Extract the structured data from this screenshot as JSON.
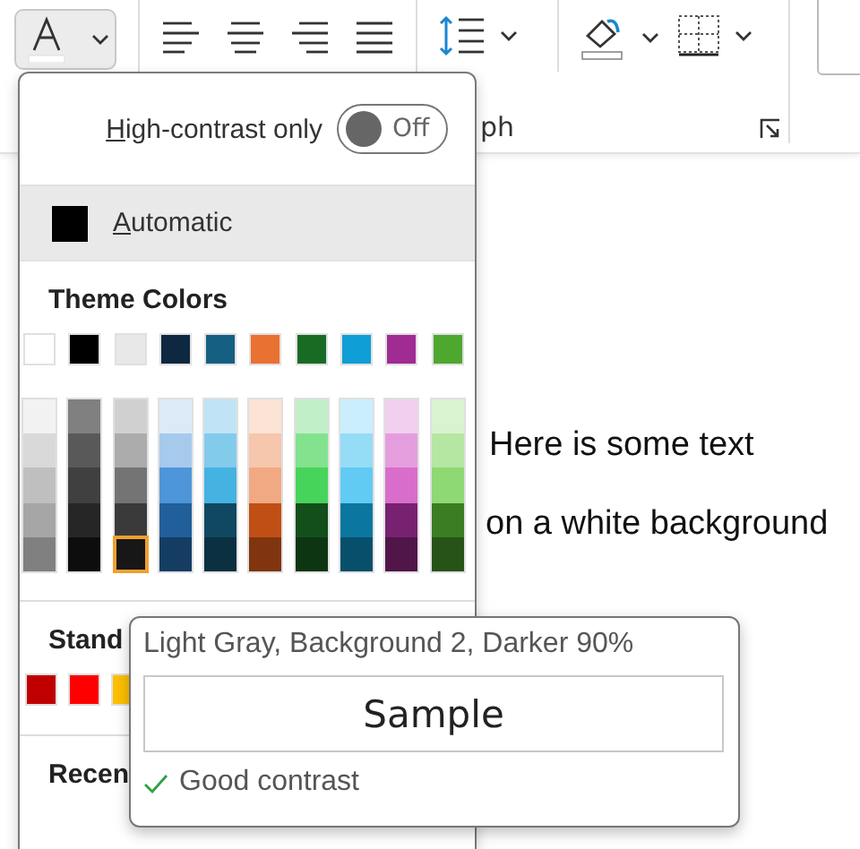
{
  "toolbar": {
    "group_label": "ph"
  },
  "document": {
    "lines": [
      "Here is some text",
      "on a white background"
    ]
  },
  "color_menu": {
    "high_contrast": {
      "label": "High-contrast only",
      "on": false,
      "state_text": "Off"
    },
    "automatic": {
      "label": "Automatic",
      "color": "#000000",
      "selected": true
    },
    "theme_title": "Theme Colors",
    "theme_colors": [
      {
        "color": "#ffffff",
        "selected": false,
        "shades": [
          {
            "color": "#f2f2f2",
            "selected": false
          },
          {
            "color": "#d9d9d9",
            "selected": false
          },
          {
            "color": "#bfbfbf",
            "selected": false
          },
          {
            "color": "#a6a6a6",
            "selected": false
          },
          {
            "color": "#808080",
            "selected": false
          }
        ]
      },
      {
        "color": "#000000",
        "selected": false,
        "shades": [
          {
            "color": "#808080",
            "selected": false
          },
          {
            "color": "#595959",
            "selected": false
          },
          {
            "color": "#404040",
            "selected": false
          },
          {
            "color": "#262626",
            "selected": false
          },
          {
            "color": "#0d0d0d",
            "selected": false
          }
        ]
      },
      {
        "color": "#e8e8e8",
        "selected": false,
        "shades": [
          {
            "color": "#d0d0d0",
            "selected": false
          },
          {
            "color": "#acacac",
            "selected": false
          },
          {
            "color": "#747474",
            "selected": false
          },
          {
            "color": "#3a3a3a",
            "selected": false
          },
          {
            "color": "#171717",
            "selected": true
          }
        ]
      },
      {
        "color": "#0e2841",
        "selected": false,
        "shades": [
          {
            "color": "#dceaf7",
            "selected": false
          },
          {
            "color": "#a6caec",
            "selected": false
          },
          {
            "color": "#4e95d9",
            "selected": false
          },
          {
            "color": "#215f9a",
            "selected": false
          },
          {
            "color": "#153d64",
            "selected": false
          }
        ]
      },
      {
        "color": "#156082",
        "selected": false,
        "shades": [
          {
            "color": "#c0e4f5",
            "selected": false
          },
          {
            "color": "#83cbeb",
            "selected": false
          },
          {
            "color": "#44b3e1",
            "selected": false
          },
          {
            "color": "#104862",
            "selected": false
          },
          {
            "color": "#0a3041",
            "selected": false
          }
        ]
      },
      {
        "color": "#e97132",
        "selected": false,
        "shades": [
          {
            "color": "#fbe3d6",
            "selected": false
          },
          {
            "color": "#f6c6ad",
            "selected": false
          },
          {
            "color": "#f1a983",
            "selected": false
          },
          {
            "color": "#c04f15",
            "selected": false
          },
          {
            "color": "#80350e",
            "selected": false
          }
        ]
      },
      {
        "color": "#196b24",
        "selected": false,
        "shades": [
          {
            "color": "#c1f0c8",
            "selected": false
          },
          {
            "color": "#83e28e",
            "selected": false
          },
          {
            "color": "#47d45a",
            "selected": false
          },
          {
            "color": "#124f1a",
            "selected": false
          },
          {
            "color": "#0d3512",
            "selected": false
          }
        ]
      },
      {
        "color": "#0f9ed5",
        "selected": false,
        "shades": [
          {
            "color": "#caeefb",
            "selected": false
          },
          {
            "color": "#95dcf7",
            "selected": false
          },
          {
            "color": "#61cbf3",
            "selected": false
          },
          {
            "color": "#0b769f",
            "selected": false
          },
          {
            "color": "#074f6a",
            "selected": false
          }
        ]
      },
      {
        "color": "#a02b93",
        "selected": false,
        "shades": [
          {
            "color": "#f2cfee",
            "selected": false
          },
          {
            "color": "#e59edd",
            "selected": false
          },
          {
            "color": "#d86dcb",
            "selected": false
          },
          {
            "color": "#782170",
            "selected": false
          },
          {
            "color": "#501549",
            "selected": false
          }
        ]
      },
      {
        "color": "#4ea72e",
        "selected": false,
        "shades": [
          {
            "color": "#d9f2d0",
            "selected": false
          },
          {
            "color": "#b5e6a2",
            "selected": false
          },
          {
            "color": "#8ed973",
            "selected": false
          },
          {
            "color": "#3a7d22",
            "selected": false
          },
          {
            "color": "#275317",
            "selected": false
          }
        ]
      }
    ],
    "standard_title": "Stand",
    "standard_colors": [
      {
        "color": "#c00000",
        "selected": false
      },
      {
        "color": "#ff0000",
        "selected": false
      },
      {
        "color": "#ffc000",
        "selected": false
      }
    ],
    "recent_title": "Recen"
  },
  "tooltip": {
    "title": "Light Gray, Background 2, Darker 90%",
    "sample": "Sample",
    "contrast": "Good contrast",
    "good": true
  }
}
